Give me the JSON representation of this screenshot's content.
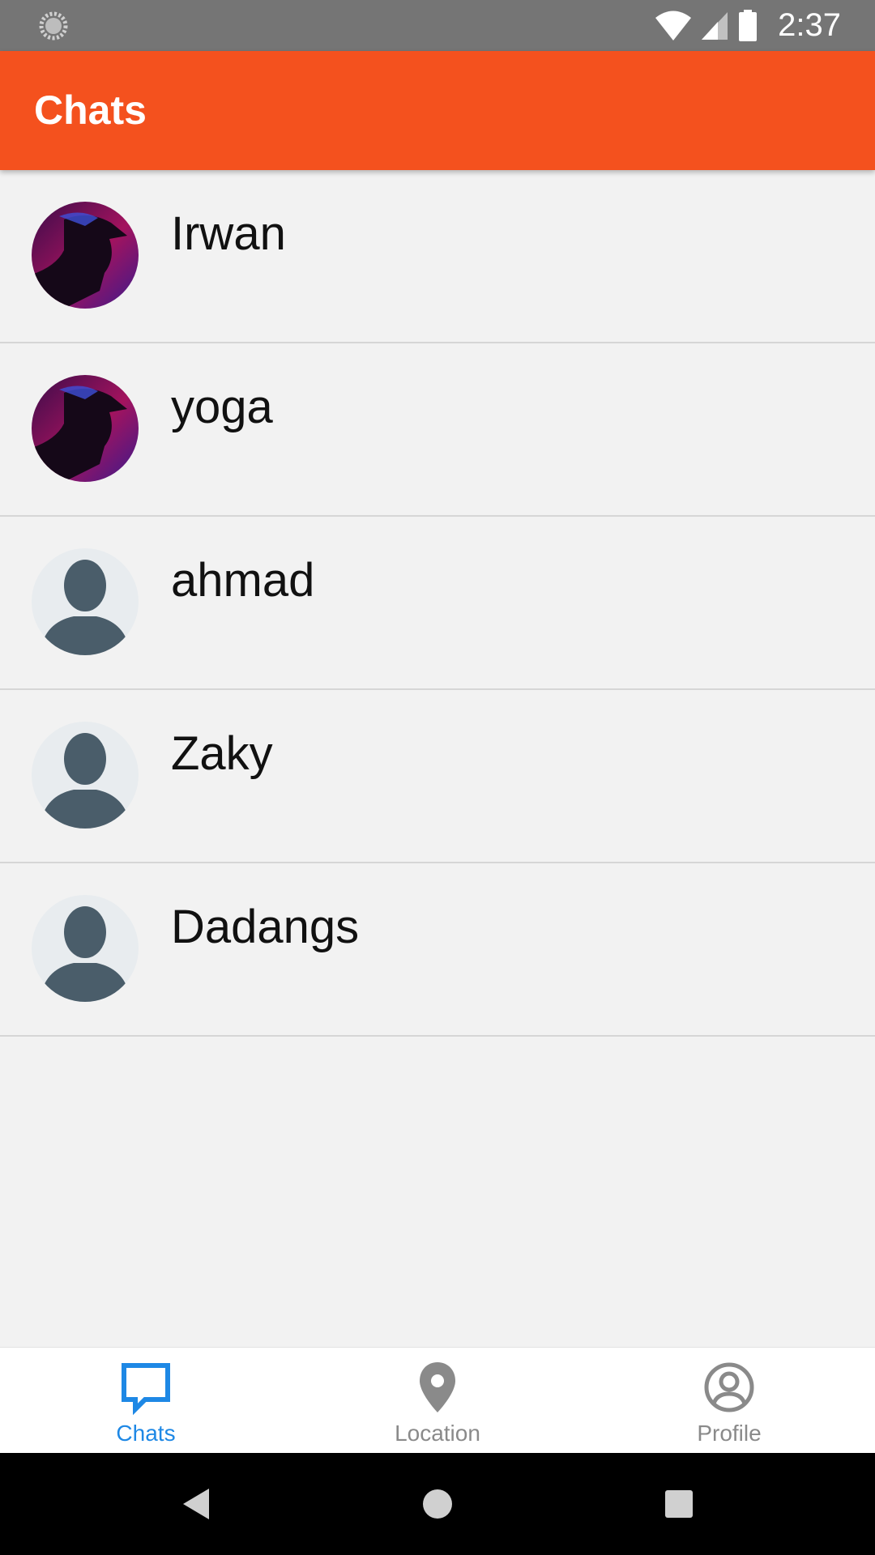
{
  "status_bar": {
    "time": "2:37",
    "icons": [
      "sync-icon",
      "wifi-icon",
      "signal-icon",
      "battery-icon"
    ],
    "background": "#757575"
  },
  "app_bar": {
    "title": "Chats",
    "background": "#f4511e"
  },
  "chats": [
    {
      "name": "Irwan",
      "avatar": "photo"
    },
    {
      "name": "yoga",
      "avatar": "photo"
    },
    {
      "name": "ahmad",
      "avatar": "default-person-icon"
    },
    {
      "name": "Zaky",
      "avatar": "default-person-icon"
    },
    {
      "name": "Dadangs",
      "avatar": "default-person-icon"
    }
  ],
  "bottom_nav": {
    "items": [
      {
        "label": "Chats",
        "icon": "chat-bubble-icon",
        "active": true
      },
      {
        "label": "Location",
        "icon": "location-pin-icon",
        "active": false
      },
      {
        "label": "Profile",
        "icon": "account-circle-icon",
        "active": false
      }
    ],
    "active_color": "#1e88e5",
    "inactive_color": "#8a8a8a"
  },
  "system_nav": {
    "icons": [
      "back-icon",
      "home-icon",
      "recents-icon"
    ]
  }
}
